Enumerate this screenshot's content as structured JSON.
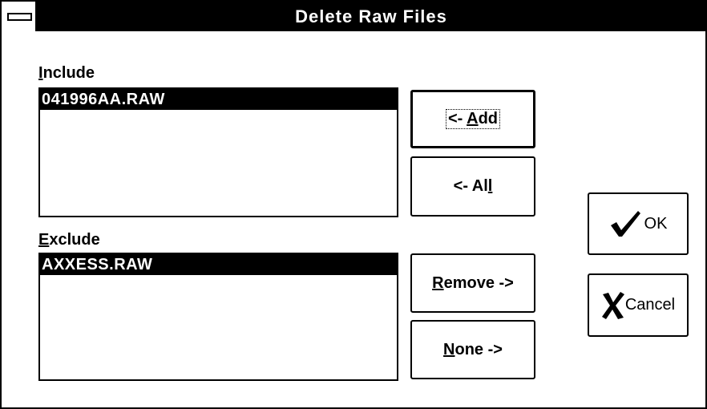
{
  "window": {
    "title": "Delete Raw Files"
  },
  "include": {
    "label_accel": "I",
    "label_rest": "nclude",
    "items": [
      "041996AA.RAW"
    ]
  },
  "exclude": {
    "label_accel": "E",
    "label_rest": "xclude",
    "items": [
      "AXXESS.RAW"
    ]
  },
  "buttons": {
    "add": {
      "prefix": "<- ",
      "accel": "A",
      "rest": "dd"
    },
    "all": {
      "prefix": "<- Al",
      "accel": "l",
      "rest": ""
    },
    "remove": {
      "prefix": "",
      "accel": "R",
      "rest": "emove ->"
    },
    "none": {
      "prefix": "",
      "accel": "N",
      "rest": "one ->"
    },
    "ok": {
      "label": "OK",
      "icon": "checkmark-icon"
    },
    "cancel": {
      "label": "Cancel",
      "icon": "x-icon"
    }
  }
}
